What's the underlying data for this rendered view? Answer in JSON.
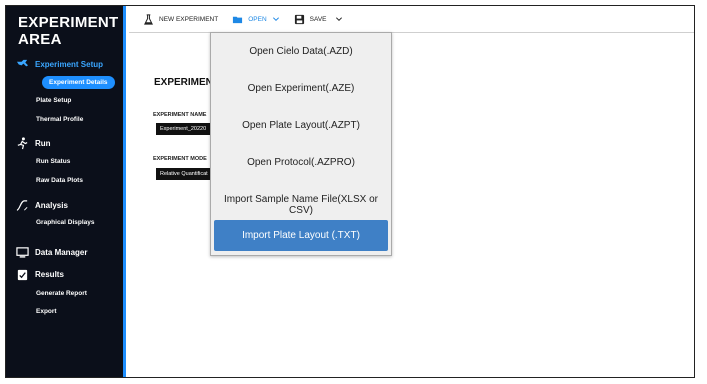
{
  "app": {
    "title_line1": "EXPERIMENT",
    "title_line2": "AREA"
  },
  "sidebar": {
    "sections": [
      {
        "label": "Experiment Setup",
        "icon": "wrench-icon",
        "active": true
      },
      {
        "label": "Run",
        "icon": "running-icon"
      },
      {
        "label": "Analysis",
        "icon": "curve-icon"
      },
      {
        "label": "Data Manager",
        "icon": "monitor-icon"
      },
      {
        "label": "Results",
        "icon": "report-icon"
      }
    ],
    "items": {
      "experiment_details": "Experiment Details",
      "plate_setup": "Plate Setup",
      "thermal_profile": "Thermal Profile",
      "run_status": "Run Status",
      "raw_data_plots": "Raw Data Plots",
      "graphical_displays": "Graphical Displays",
      "generate_report": "Generate Report",
      "export": "Export"
    }
  },
  "toolbar": {
    "new_label": "NEW EXPERIMENT",
    "open_label": "OPEN",
    "save_label": "SAVE"
  },
  "main": {
    "section_title": "EXPERIMENT",
    "name_label": "EXPERIMENT NAME",
    "name_value": "Experiment_20220",
    "mode_label": "EXPERIMENT MODE",
    "mode_value": "Relative Quantificat"
  },
  "open_menu": {
    "items": [
      "Open Cielo Data(.AZD)",
      "Open Experiment(.AZE)",
      "Open Plate Layout(.AZPT)",
      "Open Protocol(.AZPRO)",
      "Import Sample Name File(XLSX or CSV)",
      "Import Plate Layout (.TXT)"
    ],
    "selected_index": 5
  },
  "colors": {
    "accent": "#1e8fff",
    "sidebar_bg": "#0b0f1a",
    "selected": "#3f80c6"
  }
}
